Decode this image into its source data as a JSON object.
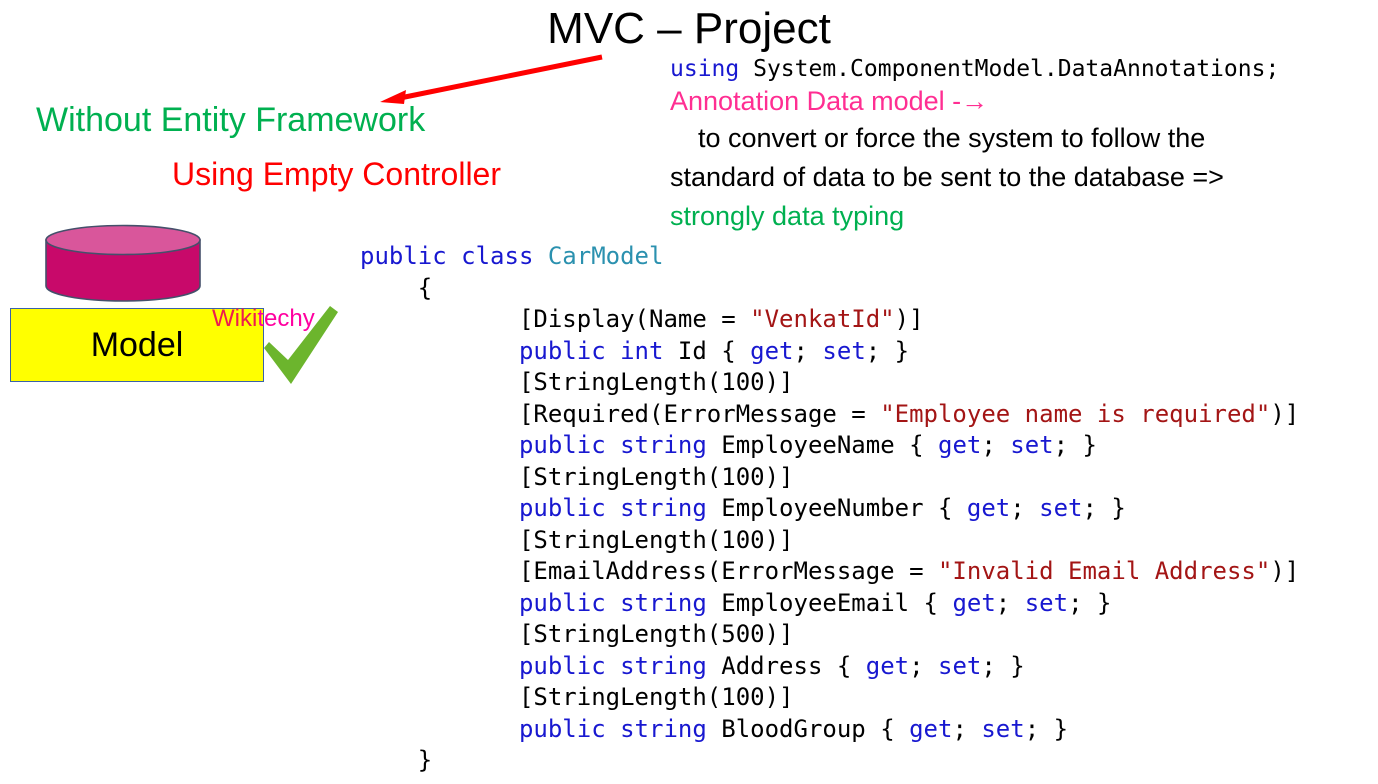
{
  "slide": {
    "title": "MVC – Project"
  },
  "labels": {
    "without_entity_framework": "Without Entity Framework",
    "using_empty_controller": "Using Empty Controller",
    "model_box": "Model"
  },
  "watermark": {
    "part_a": "Wiki",
    "part_b": "techy"
  },
  "icons": {
    "red_arrow": "arrow-left-icon",
    "green_check": "check-icon",
    "cylinder": "database-cylinder-icon"
  },
  "notes": {
    "using_keyword": "using",
    "using_namespace": " System.ComponentModel.DataAnnotations;",
    "annotation_heading": "Annotation Data model -→",
    "prose_line_1": "to convert or force the system to follow the",
    "prose_line_2": "standard of data to be sent to the database =>",
    "prose_line_3": "strongly data typing"
  },
  "code": {
    "lines": [
      {
        "indent": 0,
        "parts": [
          {
            "t": "public class ",
            "c": "kw"
          },
          {
            "t": "CarModel",
            "c": "type"
          }
        ]
      },
      {
        "indent": 4,
        "parts": [
          {
            "t": "{",
            "c": ""
          }
        ]
      },
      {
        "indent": 11,
        "parts": [
          {
            "t": "[Display(Name = ",
            "c": ""
          },
          {
            "t": "\"VenkatId\"",
            "c": "str"
          },
          {
            "t": ")]",
            "c": ""
          }
        ]
      },
      {
        "indent": 11,
        "parts": [
          {
            "t": "public int ",
            "c": "kw"
          },
          {
            "t": "Id { ",
            "c": ""
          },
          {
            "t": "get",
            "c": "kw"
          },
          {
            "t": "; ",
            "c": ""
          },
          {
            "t": "set",
            "c": "kw"
          },
          {
            "t": "; }",
            "c": ""
          }
        ]
      },
      {
        "indent": 11,
        "parts": [
          {
            "t": "[StringLength(100)]",
            "c": ""
          }
        ]
      },
      {
        "indent": 11,
        "parts": [
          {
            "t": "[Required(ErrorMessage = ",
            "c": ""
          },
          {
            "t": "\"Employee name is required\"",
            "c": "str"
          },
          {
            "t": ")]",
            "c": ""
          }
        ]
      },
      {
        "indent": 11,
        "parts": [
          {
            "t": "public string ",
            "c": "kw"
          },
          {
            "t": "EmployeeName { ",
            "c": ""
          },
          {
            "t": "get",
            "c": "kw"
          },
          {
            "t": "; ",
            "c": ""
          },
          {
            "t": "set",
            "c": "kw"
          },
          {
            "t": "; }",
            "c": ""
          }
        ]
      },
      {
        "indent": 11,
        "parts": [
          {
            "t": "[StringLength(100)]",
            "c": ""
          }
        ]
      },
      {
        "indent": 11,
        "parts": [
          {
            "t": "public string ",
            "c": "kw"
          },
          {
            "t": "EmployeeNumber { ",
            "c": ""
          },
          {
            "t": "get",
            "c": "kw"
          },
          {
            "t": "; ",
            "c": ""
          },
          {
            "t": "set",
            "c": "kw"
          },
          {
            "t": "; }",
            "c": ""
          }
        ]
      },
      {
        "indent": 11,
        "parts": [
          {
            "t": "[StringLength(100)]",
            "c": ""
          }
        ]
      },
      {
        "indent": 11,
        "parts": [
          {
            "t": "[EmailAddress(ErrorMessage = ",
            "c": ""
          },
          {
            "t": "\"Invalid Email Address\"",
            "c": "str"
          },
          {
            "t": ")]",
            "c": ""
          }
        ]
      },
      {
        "indent": 11,
        "parts": [
          {
            "t": "public string ",
            "c": "kw"
          },
          {
            "t": "EmployeeEmail { ",
            "c": ""
          },
          {
            "t": "get",
            "c": "kw"
          },
          {
            "t": "; ",
            "c": ""
          },
          {
            "t": "set",
            "c": "kw"
          },
          {
            "t": "; }",
            "c": ""
          }
        ]
      },
      {
        "indent": 11,
        "parts": [
          {
            "t": "[StringLength(500)]",
            "c": ""
          }
        ]
      },
      {
        "indent": 11,
        "parts": [
          {
            "t": "public string ",
            "c": "kw"
          },
          {
            "t": "Address { ",
            "c": ""
          },
          {
            "t": "get",
            "c": "kw"
          },
          {
            "t": "; ",
            "c": ""
          },
          {
            "t": "set",
            "c": "kw"
          },
          {
            "t": "; }",
            "c": ""
          }
        ]
      },
      {
        "indent": 11,
        "parts": [
          {
            "t": "[StringLength(100)]",
            "c": ""
          }
        ]
      },
      {
        "indent": 11,
        "parts": [
          {
            "t": "public string ",
            "c": "kw"
          },
          {
            "t": "BloodGroup { ",
            "c": ""
          },
          {
            "t": "get",
            "c": "kw"
          },
          {
            "t": "; ",
            "c": ""
          },
          {
            "t": "set",
            "c": "kw"
          },
          {
            "t": "; }",
            "c": ""
          }
        ]
      },
      {
        "indent": 4,
        "parts": [
          {
            "t": "}",
            "c": ""
          }
        ]
      }
    ]
  },
  "colors": {
    "title_text": "#000000",
    "green": "#00B050",
    "red": "#FF0000",
    "pink": "#FF2E92",
    "keyword_blue": "#1818D0",
    "type_teal": "#2B91AF",
    "string_red": "#A31515",
    "model_box_fill": "#FFFF00",
    "model_box_border": "#3A62A8",
    "cylinder_body": "#C8096A",
    "cylinder_top": "#D9569B",
    "check_green": "#6CB52D",
    "watermark_a": "#ED1C4E",
    "watermark_b": "#FF00A0"
  }
}
